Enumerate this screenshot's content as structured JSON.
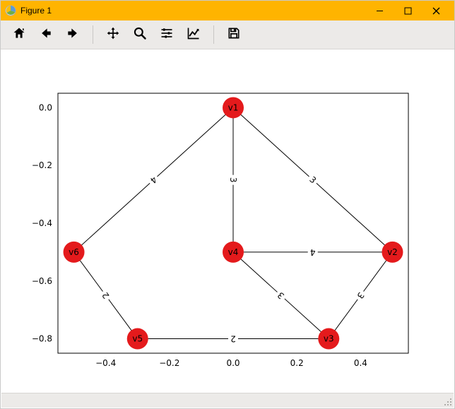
{
  "window": {
    "title": "Figure 1"
  },
  "toolbar": {
    "home": "Home",
    "back": "Back",
    "forward": "Forward",
    "pan": "Pan",
    "zoom": "Zoom",
    "subplots": "Configure subplots",
    "axes": "Edit axis",
    "save": "Save"
  },
  "chart_data": {
    "type": "graph",
    "xlim": [
      -0.55,
      0.55
    ],
    "ylim": [
      -0.85,
      0.05
    ],
    "xticks": [
      -0.4,
      -0.2,
      0.0,
      0.2,
      0.4
    ],
    "yticks": [
      0.0,
      -0.2,
      -0.4,
      -0.6,
      -0.8
    ],
    "xtick_labels": [
      "−0.4",
      "−0.2",
      "0.0",
      "0.2",
      "0.4"
    ],
    "ytick_labels": [
      "0.0",
      "−0.2",
      "−0.4",
      "−0.6",
      "−0.8"
    ],
    "nodes": [
      {
        "id": "v1",
        "x": 0.0,
        "y": 0.0
      },
      {
        "id": "v2",
        "x": 0.5,
        "y": -0.5
      },
      {
        "id": "v3",
        "x": 0.3,
        "y": -0.8
      },
      {
        "id": "v4",
        "x": 0.0,
        "y": -0.5
      },
      {
        "id": "v5",
        "x": -0.3,
        "y": -0.8
      },
      {
        "id": "v6",
        "x": -0.5,
        "y": -0.5
      }
    ],
    "edges": [
      {
        "from": "v1",
        "to": "v2",
        "w": 3
      },
      {
        "from": "v1",
        "to": "v4",
        "w": 3
      },
      {
        "from": "v1",
        "to": "v6",
        "w": 4
      },
      {
        "from": "v2",
        "to": "v3",
        "w": 3
      },
      {
        "from": "v2",
        "to": "v4",
        "w": 4
      },
      {
        "from": "v3",
        "to": "v4",
        "w": 3
      },
      {
        "from": "v3",
        "to": "v5",
        "w": 2
      },
      {
        "from": "v5",
        "to": "v6",
        "w": 2
      }
    ],
    "node_color": "#e41a1c",
    "node_radius_px": 15
  }
}
